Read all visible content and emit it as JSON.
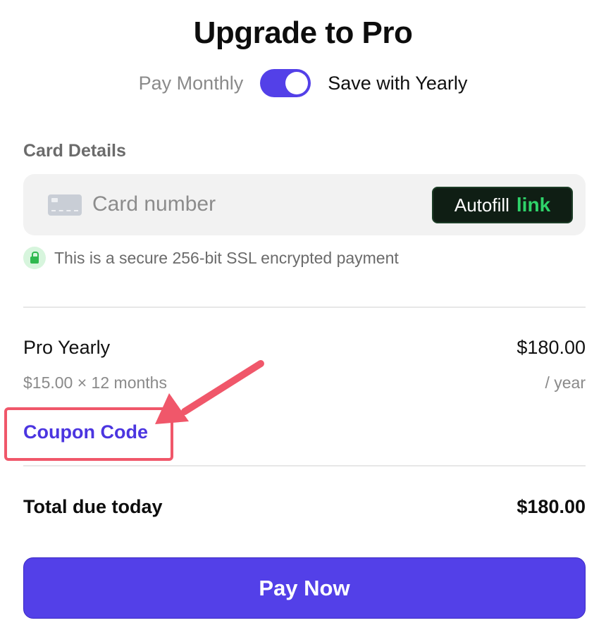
{
  "header": {
    "title": "Upgrade to Pro"
  },
  "billing": {
    "monthly_label": "Pay Monthly",
    "yearly_label": "Save with Yearly",
    "yearly_selected": true
  },
  "card": {
    "section_label": "Card Details",
    "number_placeholder": "Card number",
    "number_value": "",
    "autofill_label": "Autofill",
    "autofill_brand": "link",
    "secure_note": "This is a secure 256-bit SSL encrypted payment"
  },
  "summary": {
    "plan_name": "Pro Yearly",
    "plan_price": "$180.00",
    "plan_breakdown": "$15.00 × 12 months",
    "plan_period": "/ year",
    "coupon_label": "Coupon Code",
    "total_label": "Total due today",
    "total_amount": "$180.00"
  },
  "actions": {
    "pay_label": "Pay Now"
  },
  "colors": {
    "accent": "#5340e8",
    "link": "#4b35e0",
    "annotation": "#f0576a",
    "autofill_bg": "#0f1e14",
    "autofill_brand": "#2fd36a",
    "secure_green": "#2fb84e"
  },
  "icons": {
    "card": "credit-card-icon",
    "lock": "lock-icon",
    "annotation_arrow": "arrow-icon"
  }
}
